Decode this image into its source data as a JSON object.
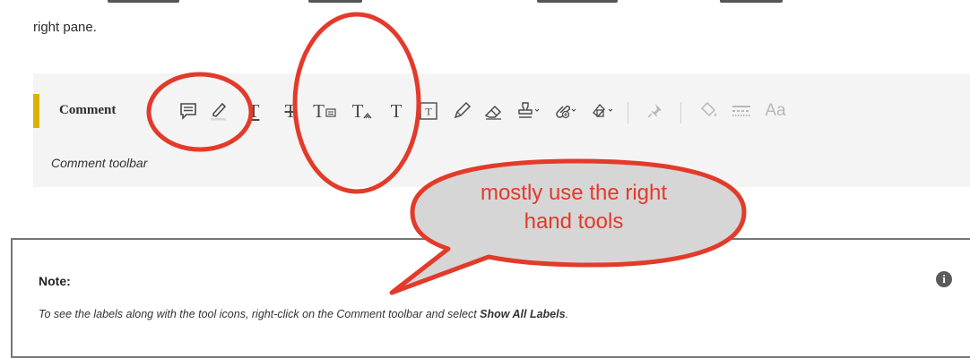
{
  "intro": {
    "text": "right pane."
  },
  "toolbar": {
    "title": "Comment",
    "caption": "Comment toolbar",
    "accent_color": "#d7b40a",
    "tools": [
      {
        "name": "sticky-note-icon"
      },
      {
        "name": "highlight-icon"
      },
      {
        "name": "underline-text-icon",
        "glyph": "T"
      },
      {
        "name": "strikethrough-text-icon",
        "glyph": "T"
      },
      {
        "name": "replace-text-icon",
        "glyph": "T"
      },
      {
        "name": "insert-text-icon",
        "glyph": "T"
      },
      {
        "name": "add-text-comment-icon",
        "glyph": "T"
      },
      {
        "name": "text-box-icon",
        "glyph": "T"
      },
      {
        "name": "pencil-icon"
      },
      {
        "name": "eraser-icon"
      },
      {
        "name": "stamp-icon"
      },
      {
        "name": "attach-file-icon"
      },
      {
        "name": "drawing-tools-icon"
      },
      {
        "name": "pin-icon"
      },
      {
        "name": "fill-color-icon"
      },
      {
        "name": "line-style-icon"
      },
      {
        "name": "font-icon",
        "glyph": "Aa"
      }
    ]
  },
  "annotation": {
    "color": "#e33a2a",
    "bubble_color": "#d6d6d6",
    "bubble_line1": "mostly use the right",
    "bubble_line2": "hand tools"
  },
  "note": {
    "title": "Note:",
    "text_before": "To see the labels along with the tool icons, right-click on the Comment toolbar and select ",
    "text_bold": "Show All Labels",
    "text_after": "."
  }
}
